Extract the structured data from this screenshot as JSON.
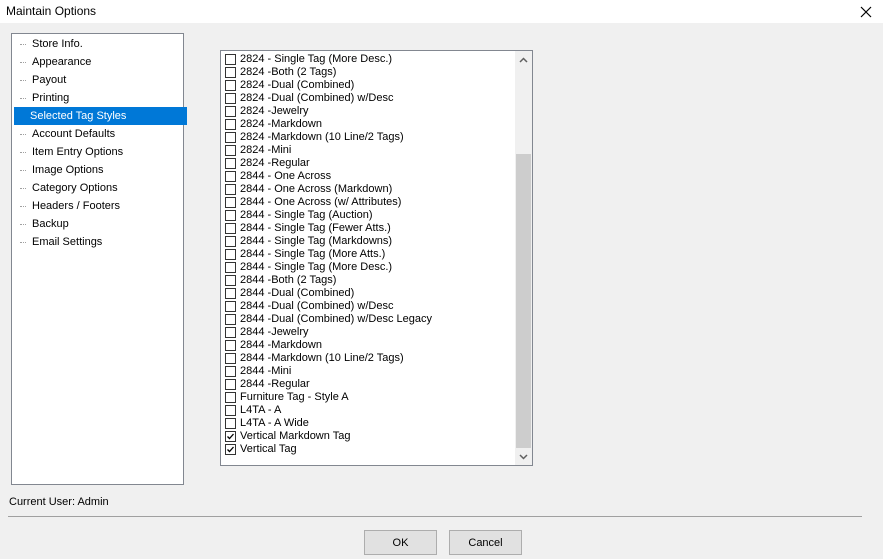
{
  "window": {
    "title": "Maintain Options"
  },
  "tree": {
    "items": [
      {
        "label": "Store Info.",
        "selected": false
      },
      {
        "label": "Appearance",
        "selected": false
      },
      {
        "label": "Payout",
        "selected": false
      },
      {
        "label": "Printing",
        "selected": false
      },
      {
        "label": "Selected Tag Styles",
        "selected": true
      },
      {
        "label": "Account Defaults",
        "selected": false
      },
      {
        "label": "Item Entry Options",
        "selected": false
      },
      {
        "label": "Image Options",
        "selected": false
      },
      {
        "label": "Category Options",
        "selected": false
      },
      {
        "label": "Headers / Footers",
        "selected": false
      },
      {
        "label": "Backup",
        "selected": false
      },
      {
        "label": "Email Settings",
        "selected": false
      }
    ]
  },
  "tag_list": {
    "items": [
      {
        "label": "2824 - Single Tag (More Desc.)",
        "checked": false
      },
      {
        "label": "2824 -Both (2 Tags)",
        "checked": false
      },
      {
        "label": "2824 -Dual (Combined)",
        "checked": false
      },
      {
        "label": "2824 -Dual (Combined) w/Desc",
        "checked": false
      },
      {
        "label": "2824 -Jewelry",
        "checked": false
      },
      {
        "label": "2824 -Markdown",
        "checked": false
      },
      {
        "label": "2824 -Markdown (10 Line/2 Tags)",
        "checked": false
      },
      {
        "label": "2824 -Mini",
        "checked": false
      },
      {
        "label": "2824 -Regular",
        "checked": false
      },
      {
        "label": "2844 - One Across",
        "checked": false
      },
      {
        "label": "2844 - One Across (Markdown)",
        "checked": false
      },
      {
        "label": "2844 - One Across (w/ Attributes)",
        "checked": false
      },
      {
        "label": "2844 - Single Tag (Auction)",
        "checked": false
      },
      {
        "label": "2844 - Single Tag (Fewer Atts.)",
        "checked": false
      },
      {
        "label": "2844 - Single Tag (Markdowns)",
        "checked": false
      },
      {
        "label": "2844 - Single Tag (More Atts.)",
        "checked": false
      },
      {
        "label": "2844 - Single Tag (More Desc.)",
        "checked": false
      },
      {
        "label": "2844 -Both (2 Tags)",
        "checked": false
      },
      {
        "label": "2844 -Dual (Combined)",
        "checked": false
      },
      {
        "label": "2844 -Dual (Combined) w/Desc",
        "checked": false
      },
      {
        "label": "2844 -Dual (Combined) w/Desc Legacy",
        "checked": false
      },
      {
        "label": "2844 -Jewelry",
        "checked": false
      },
      {
        "label": "2844 -Markdown",
        "checked": false
      },
      {
        "label": "2844 -Markdown (10 Line/2 Tags)",
        "checked": false
      },
      {
        "label": "2844 -Mini",
        "checked": false
      },
      {
        "label": "2844 -Regular",
        "checked": false
      },
      {
        "label": "Furniture Tag - Style A",
        "checked": false
      },
      {
        "label": "L4TA - A",
        "checked": false
      },
      {
        "label": "L4TA - A Wide",
        "checked": false
      },
      {
        "label": "Vertical Markdown Tag",
        "checked": true
      },
      {
        "label": "Vertical Tag",
        "checked": true
      }
    ]
  },
  "status": {
    "current_user": "Current User: Admin"
  },
  "buttons": {
    "ok": "OK",
    "cancel": "Cancel"
  },
  "colors": {
    "selection": "#0078d7",
    "background": "#f0f0f0"
  },
  "icons": {
    "close": "close-icon",
    "scroll_up": "chevron-up-icon",
    "scroll_down": "chevron-down-icon",
    "check": "checkmark-icon"
  }
}
